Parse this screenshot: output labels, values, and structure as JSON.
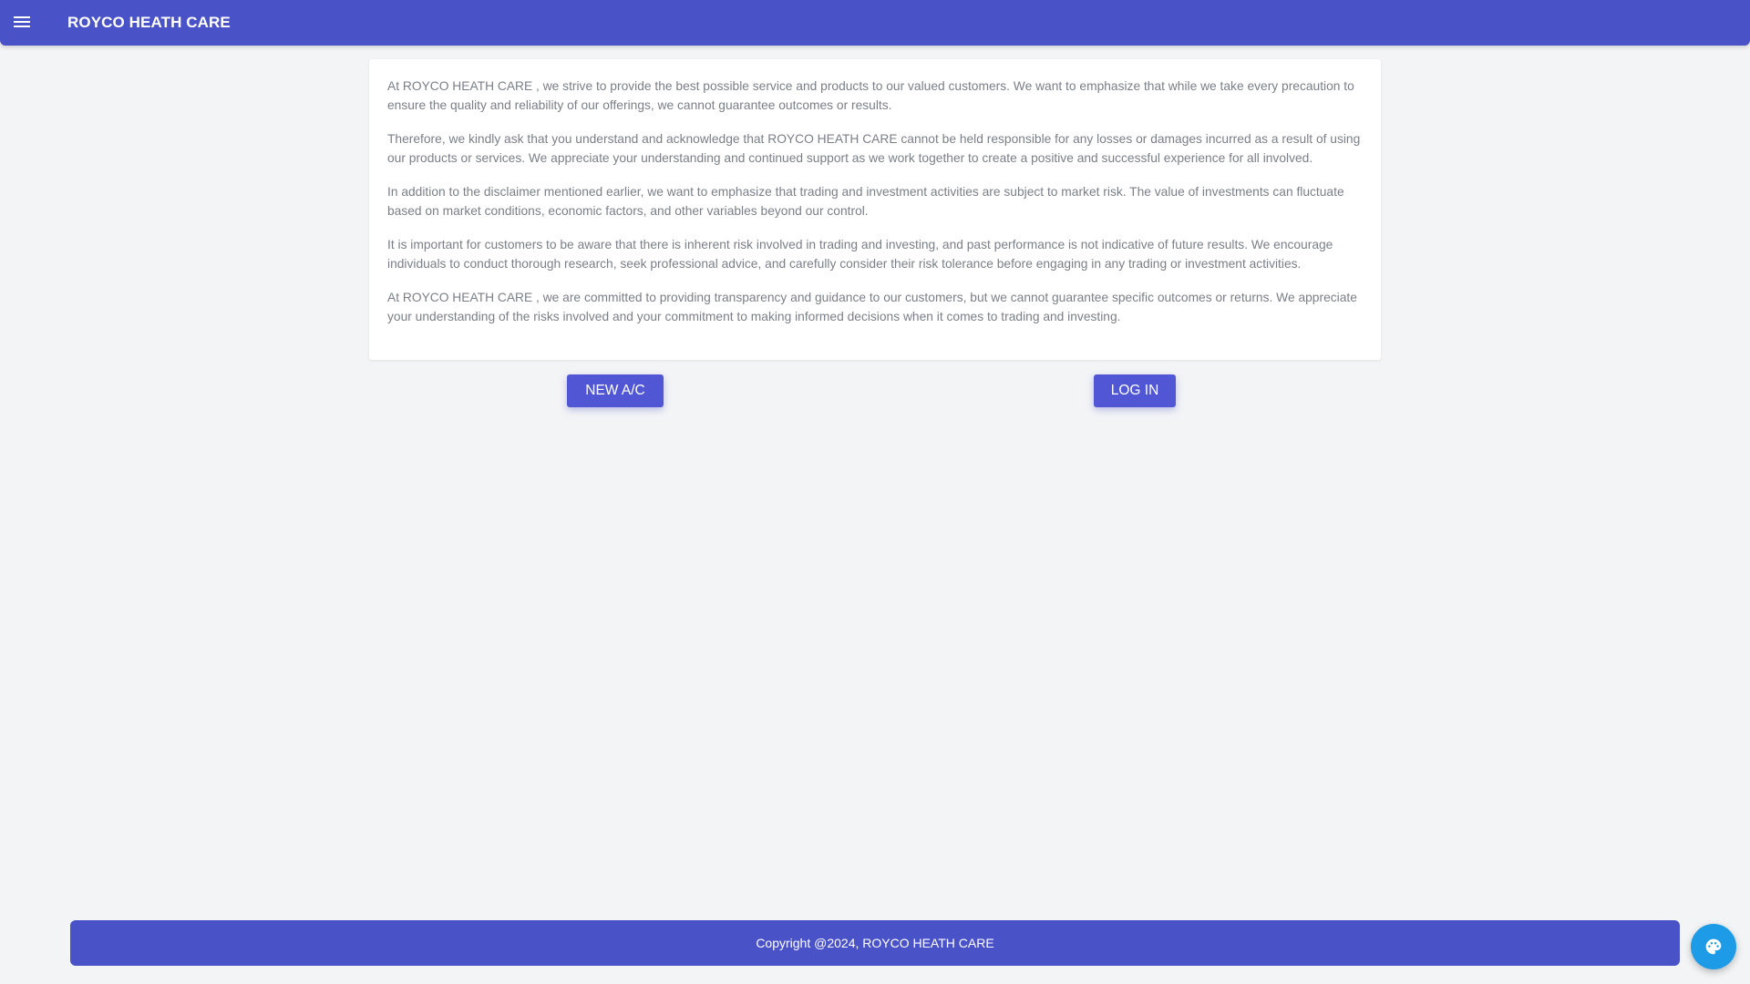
{
  "header": {
    "brand": "ROYCO HEATH CARE",
    "menu_icon": "hamburger-menu-icon"
  },
  "disclaimer": {
    "paragraphs": [
      "At ROYCO HEATH CARE , we strive to provide the best possible service and products to our valued customers. We want to emphasize that while we take every precaution to ensure the quality and reliability of our offerings, we cannot guarantee outcomes or results.",
      "Therefore, we kindly ask that you understand and acknowledge that ROYCO HEATH CARE cannot be held responsible for any losses or damages incurred as a result of using our products or services. We appreciate your understanding and continued support as we work together to create a positive and successful experience for all involved.",
      "In addition to the disclaimer mentioned earlier, we want to emphasize that trading and investment activities are subject to market risk. The value of investments can fluctuate based on market conditions, economic factors, and other variables beyond our control.",
      "It is important for customers to be aware that there is inherent risk involved in trading and investing, and past performance is not indicative of future results. We encourage individuals to conduct thorough research, seek professional advice, and carefully consider their risk tolerance before engaging in any trading or investment activities.",
      "At ROYCO HEATH CARE , we are committed to providing transparency and guidance to our customers, but we cannot guarantee specific outcomes or returns. We appreciate your understanding of the risks involved and your commitment to making informed decisions when it comes to trading and investing."
    ]
  },
  "actions": {
    "new_account_label": "NEW A/C",
    "login_label": "LOG IN"
  },
  "footer": {
    "copyright": "Copyright @2024, ROYCO HEATH CARE"
  },
  "theme_button": {
    "icon": "palette-icon"
  },
  "colors": {
    "primary": "#4a52c8",
    "button": "#5157d4",
    "fab": "#1e9be6",
    "background": "#f3f4f6",
    "text_muted": "#7a7f87"
  }
}
